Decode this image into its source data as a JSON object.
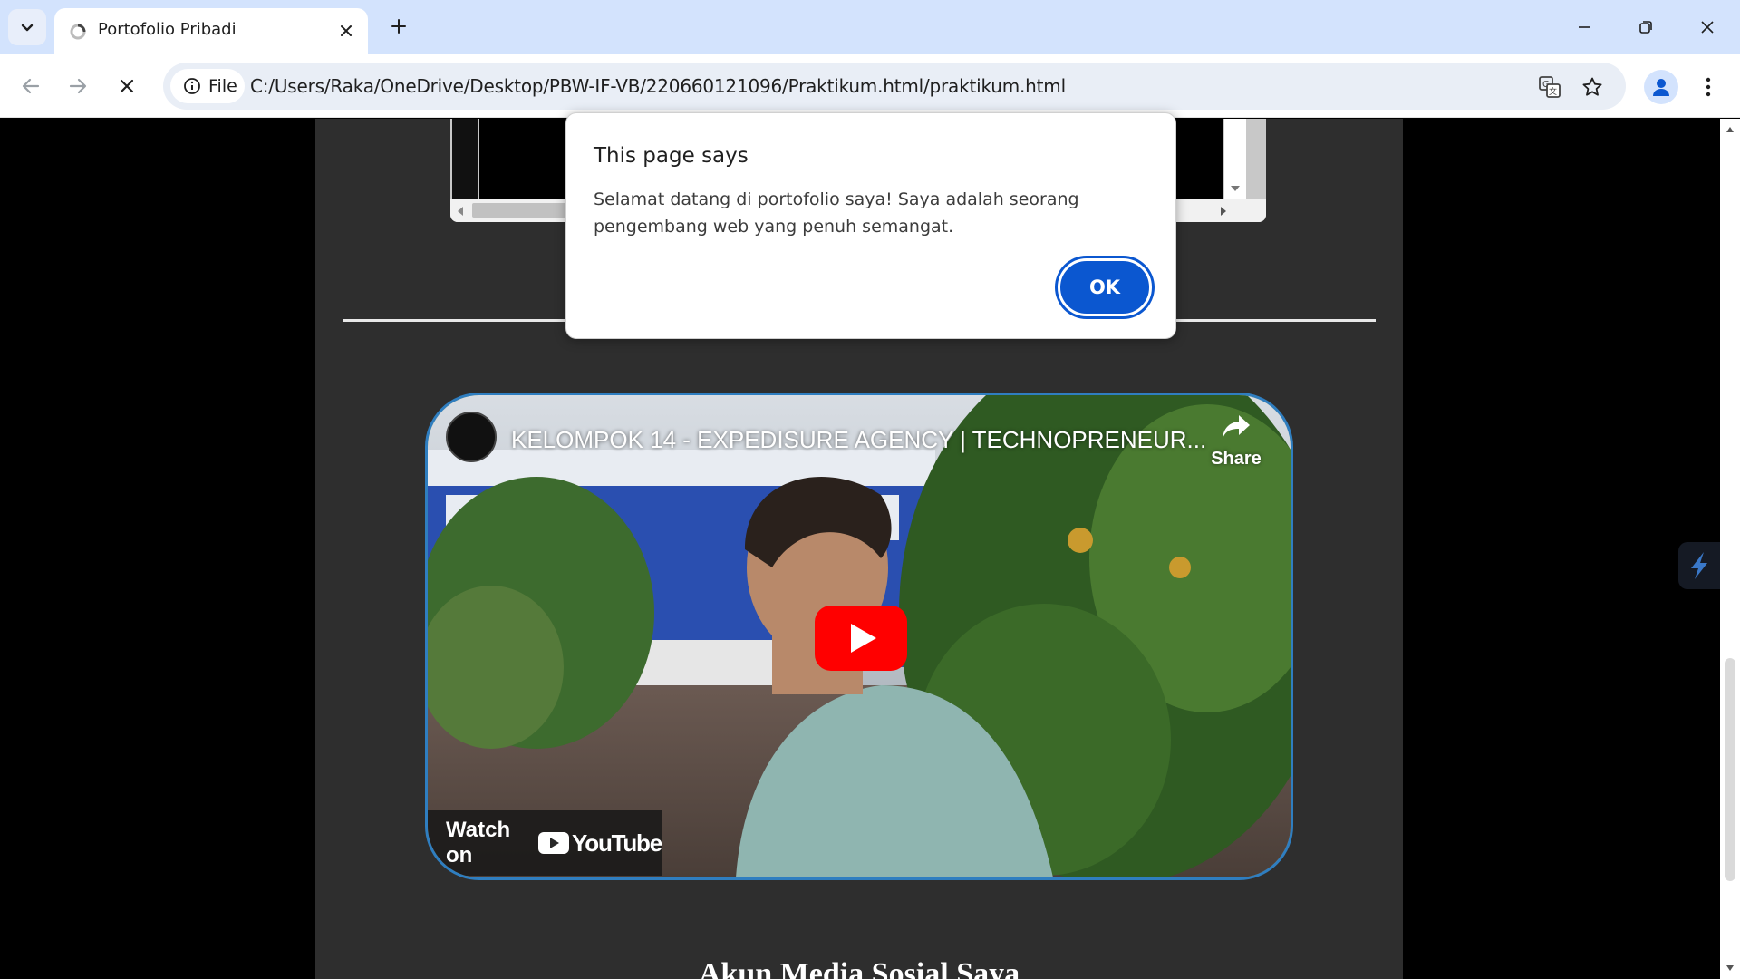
{
  "browser": {
    "tab": {
      "title": "Portofolio Pribadi"
    },
    "address_bar": {
      "chip_label": "File",
      "url": "C:/Users/Raka/OneDrive/Desktop/PBW-IF-VB/220660121096/Praktikum.html/praktikum.html"
    },
    "icons": {
      "tab_search": "chevron-down-icon",
      "favicon": "loading-favicon-icon",
      "close_tab": "close-icon",
      "new_tab": "plus-icon",
      "back": "arrow-left-icon",
      "forward": "arrow-right-icon",
      "stop": "close-icon",
      "info": "info-icon",
      "translate": "translate-icon",
      "bookmark": "star-icon",
      "profile": "person-icon",
      "menu": "kebab-icon",
      "minimize": "minimize-icon",
      "restore": "restore-icon",
      "close_window": "close-icon"
    },
    "colors": {
      "tabstrip": "#d3e3fd",
      "omnibox": "#e9eef6",
      "accent": "#0b57d0"
    }
  },
  "page": {
    "video": {
      "title": "KELOMPOK 14 - EXPEDISURE AGENCY | TECHNOPRENEUR...",
      "share_label": "Share",
      "watch_on_label": "Watch on",
      "youtube_label": "YouTube",
      "border_color": "#2f7ec0"
    },
    "section_heading": "Akun Media Sosial Saya"
  },
  "dialog": {
    "title": "This page says",
    "message": "Selamat datang di portofolio saya! Saya adalah seorang pengembang web yang penuh semangat.",
    "ok_label": "OK"
  }
}
